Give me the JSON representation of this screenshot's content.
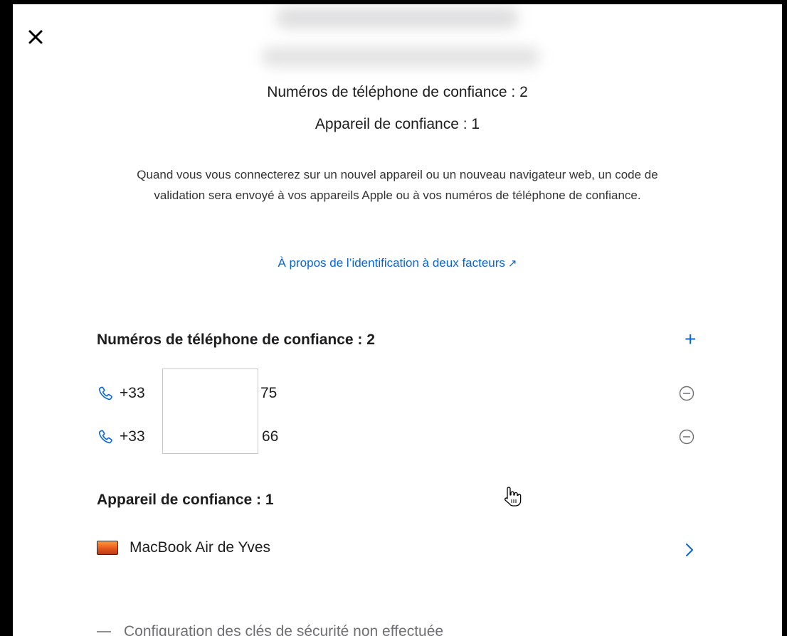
{
  "summary": {
    "phones": "Numéros de téléphone de confiance : 2",
    "device": "Appareil de confiance : 1"
  },
  "description": "Quand vous vous connecterez sur un nouvel appareil ou un nouveau navigateur web, un code de validation sera envoyé à vos appareils Apple ou à vos numéros de téléphone de confiance.",
  "link": {
    "label": "À propos de l’identification à deux facteurs",
    "arrow": "↗"
  },
  "phones_section": {
    "title": "Numéros de téléphone de confiance : 2",
    "add_icon": "plus-icon",
    "items": [
      {
        "prefix": "+33",
        "suffix": "75",
        "remove_icon": "minus-circle-icon"
      },
      {
        "prefix": "+33",
        "suffix": "66",
        "remove_icon": "minus-circle-icon"
      }
    ]
  },
  "device_section": {
    "title": "Appareil de confiance : 1",
    "items": [
      {
        "name": "MacBook Air de Yves",
        "icon": "macbook-icon"
      }
    ]
  },
  "footer": {
    "text": "Configuration des clés de sécurité non effectuée"
  },
  "colors": {
    "accent": "#0a66d0",
    "text": "#1d1d1f",
    "secondary_text": "#6e6e73",
    "background": "#ffffff"
  }
}
